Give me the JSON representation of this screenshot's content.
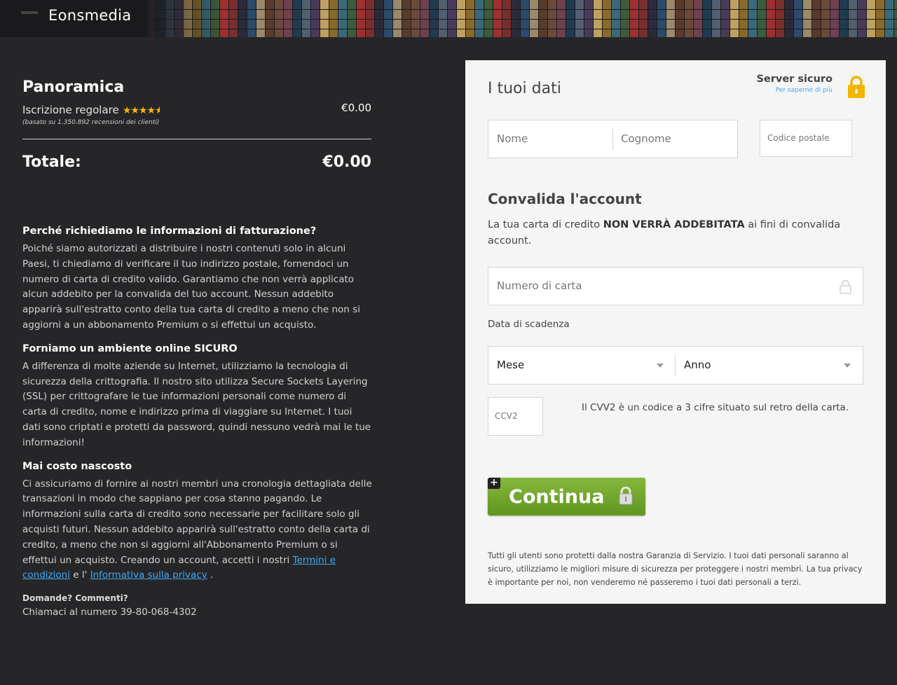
{
  "header": {
    "brand": "Eonsmedia"
  },
  "overview": {
    "title": "Panoramica",
    "plan": "Iscrizione regolare",
    "rating_stars": 4.5,
    "stars_glyphs": "★★★★",
    "half_star": "★",
    "plan_price": "€0.00",
    "reviews": "(basato su 1.350.892 recensioni dei clienti)",
    "total_label": "Totale:",
    "total_value": "€0.00"
  },
  "info": {
    "billing_title": "Perché richiediamo le informazioni di fatturazione?",
    "billing_text": "Poiché siamo autorizzati a distribuire i nostri contenuti solo in alcuni Paesi, ti chiediamo di verificare il tuo indirizzo postale, fornendoci un numero di carta di credito valido. Garantiamo che non verrà applicato alcun addebito per la convalida del tuo account. Nessun addebito apparirà sull'estratto conto della tua carta di credito a meno che non si aggiorni a un abbonamento Premium o si effettui un acquisto.",
    "secure_title": "Forniamo un ambiente online SICURO",
    "secure_text": "A differenza di molte aziende su Internet, utilizziamo la tecnologia di sicurezza della crittografia. Il nostro sito utilizza Secure Sockets Layering (SSL) per crittografare le tue informazioni personali come numero di carta di credito, nome e indirizzo prima di viaggiare su Internet. I tuoi dati sono criptati e protetti da password, quindi nessuno vedrà mai le tue informazioni!",
    "hidden_title": "Mai costo nascosto",
    "hidden_text": "Ci assicuriamo di fornire ai nostri membri una cronologia dettagliata delle transazioni in modo che sappiano per cosa stanno pagando. Le informazioni sulla carta di credito sono necessarie per facilitare solo gli acquisti futuri. Nessun addebito apparirà sull'estratto conto della carta di credito, a meno che non si aggiorni all'Abbonamento Premium o si effettui un acquisto. Creando un account, accetti i nostri",
    "terms_link": "Termini e condizioni",
    "and_text": "e l'",
    "privacy_link": "Informativa sulla privacy",
    "end_text": ".",
    "contact_q": "Domande? Commenti?",
    "contact_a": "Chiamaci al numero 39-80-068-4302"
  },
  "form": {
    "title": "I tuoi dati",
    "secure_title": "Server sicuro",
    "secure_link": "Per saperne di più",
    "first_name_placeholder": "Nome",
    "last_name_placeholder": "Cognome",
    "zip_placeholder": "Codice postale",
    "validate_title": "Convalida l'account",
    "validate_text_pre": "La tua carta di credito ",
    "validate_text_bold": "NON VERRÀ ADDEBITATA",
    "validate_text_post": " ai fini di convalida account.",
    "card_placeholder": "Numero di carta",
    "expiry_label": "Data di scadenza",
    "month_selected": "Mese",
    "year_selected": "Anno",
    "cvv_placeholder": "CCV2",
    "cvv_help": "Il CVV2 è un codice a 3 cifre situato sul retro della carta.",
    "continue_label": "Continua",
    "continue_plus": "+",
    "note": "Tutti gli utenti sono protetti dalla nostra Garanzia di Servizio. I tuoi dati personali saranno al sicuro, utilizziamo le migliori misure di sicurezza per proteggere i nostri membri. La tua privacy è importante per noi, non venderemo né passeremo i tuoi dati personali a terzi."
  },
  "colors": {
    "background": "#262629",
    "panel": "#f5f5f5",
    "accent_link": "#3fa9f5",
    "star": "#f5b400",
    "button": "#6fa42c",
    "lock": "#f5b400"
  },
  "icons": {
    "secure_lock": "padlock-icon",
    "card_lock": "lock-outline-icon",
    "dropdown": "caret-down-icon",
    "button_lock": "padlock-icon"
  }
}
